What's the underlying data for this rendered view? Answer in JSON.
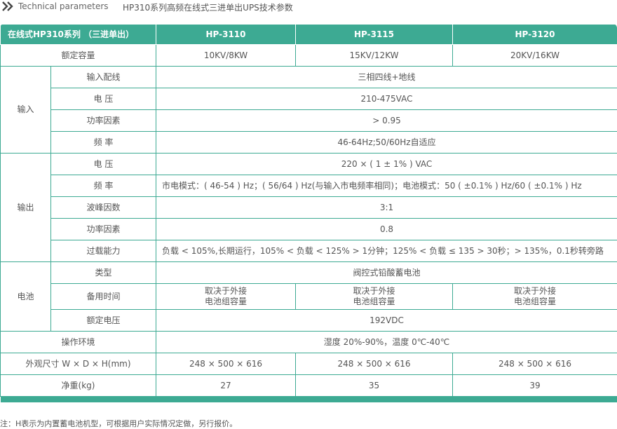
{
  "header": {
    "en_title": "Technical parameters",
    "cn_title": "HP310系列高频在线式三进单出UPS技术参数"
  },
  "table": {
    "head": {
      "series": "在线式HP310系列 （三进单出）",
      "models": [
        "HP-3110",
        "HP-3115",
        "HP-3120"
      ]
    },
    "capacity": {
      "label": "额定容量",
      "values": [
        "10KV/8KW",
        "15KV/12KW",
        "20KV/16KW"
      ]
    },
    "input": {
      "group": "输入",
      "wiring_label": "输入配线",
      "wiring": "三相四线+地线",
      "voltage_label": "电 压",
      "voltage": "210-475VAC",
      "pf_label": "功率因素",
      "pf": "> 0.95",
      "freq_label": "频 率",
      "freq": "46-64Hz;50/60Hz自适应"
    },
    "output": {
      "group": "输出",
      "voltage_label": "电 压",
      "voltage": "220 × ( 1 ± 1% ) VAC",
      "freq_label": "频 率",
      "freq": "市电模式：( 46-54 ) Hz；( 56/64 ) Hz(与输入市电频率相同)；电池模式：50 ( ±0.1% ) Hz/60 ( ±0.1% ) Hz",
      "crest_label": "波峰因数",
      "crest": "3:1",
      "pf_label": "功率因素",
      "pf": "0.8",
      "overload_label": "过载能力",
      "overload": "负载 < 105%,长期运行，105% < 负载 < 125% > 1分钟；125% < 负载 ≤ 135 > 30秒；> 135%，0.1秒转旁路"
    },
    "battery": {
      "group": "电池",
      "type_label": "类型",
      "type": "阀控式铅酸蓄电池",
      "backup_label": "备用时间",
      "backup_line1": [
        "取决于外接",
        "取决于外接",
        "取决于外接"
      ],
      "backup_line2": [
        "电池组容量",
        "电池组容量",
        "电池组容量"
      ],
      "voltage_label": "额定电压",
      "voltage": "192VDC"
    },
    "env": {
      "label": "操作环境",
      "value": "湿度 20%-90%，温度 0℃-40℃"
    },
    "size": {
      "label": "外观尺寸 W × D × H(mm)",
      "values": [
        "248 × 500 × 616",
        "248 × 500 × 616",
        "248 × 500 × 616"
      ]
    },
    "weight": {
      "label": "净重(kg)",
      "values": [
        "27",
        "35",
        "39"
      ]
    }
  },
  "note": "注：H表示为内置蓄电池机型，可根据用户实际情况定做，另行报价。",
  "colors": {
    "accent": "#3daa93",
    "text": "#555555"
  },
  "icons": {
    "title_marker": "double-chevron-right-icon"
  }
}
